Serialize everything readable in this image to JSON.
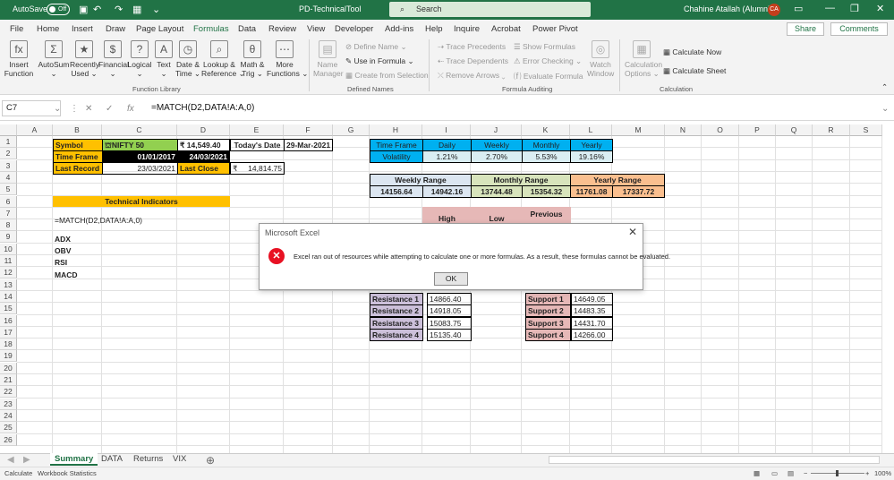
{
  "title": {
    "autosave": "AutoSave",
    "autosave_state": "Off",
    "doc": "PD-TechnicalTool",
    "search": "Search",
    "user": "Chahine Atallah (Alumni)",
    "initials": "CA"
  },
  "tabs": [
    "File",
    "Home",
    "Insert",
    "Draw",
    "Page Layout",
    "Formulas",
    "Data",
    "Review",
    "View",
    "Developer",
    "Add-ins",
    "Help",
    "Inquire",
    "Acrobat",
    "Power Pivot"
  ],
  "share": "Share",
  "comments": "Comments",
  "ribbon": {
    "library": [
      {
        "l1": "Insert",
        "l2": "Function",
        "icon": "fx"
      },
      {
        "l1": "AutoSum",
        "l2": "⌄",
        "icon": "Σ"
      },
      {
        "l1": "Recently",
        "l2": "Used ⌄",
        "icon": "★"
      },
      {
        "l1": "Financial",
        "l2": "⌄",
        "icon": "$"
      },
      {
        "l1": "Logical",
        "l2": "⌄",
        "icon": "?"
      },
      {
        "l1": "Text",
        "l2": "⌄",
        "icon": "A"
      },
      {
        "l1": "Date &",
        "l2": "Time ⌄",
        "icon": "◷"
      },
      {
        "l1": "Lookup &",
        "l2": "Reference ⌄",
        "icon": "⌕"
      },
      {
        "l1": "Math &",
        "l2": "Trig ⌄",
        "icon": "θ"
      },
      {
        "l1": "More",
        "l2": "Functions ⌄",
        "icon": "⋯"
      }
    ],
    "library_group": "Function Library",
    "names": {
      "manager1": "Name",
      "manager2": "Manager",
      "define": "Define Name",
      "use": "Use in Formula",
      "create": "Create from Selection",
      "group": "Defined Names"
    },
    "audit": {
      "prec": "Trace Precedents",
      "dep": "Trace Dependents",
      "remove": "Remove Arrows",
      "show": "Show Formulas",
      "err": "Error Checking",
      "eval": "Evaluate Formula",
      "watch1": "Watch",
      "watch2": "Window",
      "group": "Formula Auditing"
    },
    "calc": {
      "opt1": "Calculation",
      "opt2": "Options ⌄",
      "now": "Calculate Now",
      "sheet": "Calculate Sheet",
      "group": "Calculation"
    }
  },
  "formula_bar": {
    "name_box": "C7",
    "formula": "=MATCH(D2,DATA!A:A,0)"
  },
  "columns": [
    "A",
    "B",
    "C",
    "D",
    "E",
    "F",
    "G",
    "H",
    "I",
    "J",
    "K",
    "L",
    "M",
    "N",
    "O",
    "P",
    "Q",
    "R",
    "S"
  ],
  "rows": [
    "1",
    "2",
    "3",
    "4",
    "5",
    "6",
    "7",
    "8",
    "9",
    "10",
    "11",
    "12",
    "13",
    "14",
    "15",
    "16",
    "17",
    "18",
    "19",
    "20",
    "21",
    "22",
    "23",
    "24",
    "25",
    "26"
  ],
  "cells": {
    "symbol": "Symbol",
    "nifty": "NIFTY 50",
    "price": "₹  14,549.40",
    "today_lbl": "Today's Date",
    "today": "29-Mar-2021",
    "timeframe": "Time Frame",
    "start": "01/01/2017",
    "end": "24/03/2021",
    "last_record": "Last Record",
    "last_date": "23/03/2021",
    "last_close_lbl": "Last Close",
    "rupee": "₹",
    "last_close": "14,814.75",
    "tech_ind": "Technical Indicators",
    "b7": "=MATCH(D2,DATA!A:A,0)",
    "adx": "ADX",
    "obv": "OBV",
    "rsi": "RSI",
    "macd": "MACD",
    "tf_hdr": "Time Frame",
    "daily": "Daily",
    "weekly": "Weekly",
    "monthly": "Monthly",
    "yearly": "Yearly",
    "volatility": "Volatility",
    "v_d": "1.21%",
    "v_w": "2.70%",
    "v_m": "5.53%",
    "v_y": "19.16%",
    "wr": "Weekly Range",
    "wr1": "14156.64",
    "wr2": "14942.16",
    "mr": "Monthly Range",
    "mr1": "13744.48",
    "mr2": "15354.32",
    "yr": "Yearly Range",
    "yr1": "11761.08",
    "yr2": "17337.72",
    "high": "High",
    "low": "Low",
    "previous": "Previous",
    "res": [
      {
        "l": "Resistance 1",
        "v": "14866.40"
      },
      {
        "l": "Resistance 2",
        "v": "14918.05"
      },
      {
        "l": "Resistance 3",
        "v": "15083.75"
      },
      {
        "l": "Resistance 4",
        "v": "15135.40"
      }
    ],
    "sup": [
      {
        "l": "Support 1",
        "v": "14649.05"
      },
      {
        "l": "Support 2",
        "v": "14483.35"
      },
      {
        "l": "Support 3",
        "v": "14431.70"
      },
      {
        "l": "Support 4",
        "v": "14266.00"
      }
    ]
  },
  "dialog": {
    "title": "Microsoft Excel",
    "message": "Excel ran out of resources while attempting to calculate one or more formulas. As a result, these formulas cannot be evaluated.",
    "ok": "OK"
  },
  "sheets": [
    "Summary",
    "DATA",
    "Returns",
    "VIX"
  ],
  "status": {
    "left1": "Calculate",
    "left2": "Workbook Statistics",
    "zoom": "100%"
  }
}
